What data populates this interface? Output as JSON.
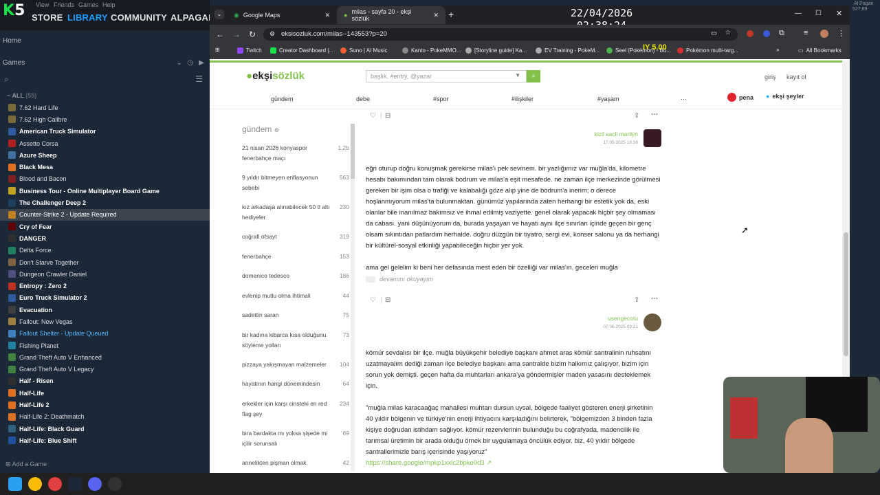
{
  "steam": {
    "brand": "5",
    "menu": [
      "View",
      "Friends",
      "Games",
      "Help"
    ],
    "nav": [
      "STORE",
      "LIBRARY",
      "COMMUNITY",
      "ALPAGAN"
    ],
    "home": "Home",
    "games_header": "Games",
    "all_label": "ALL",
    "all_count": "(55)",
    "games": [
      {
        "name": "7.62 Hard Life",
        "icon_color": "#7a6a3a"
      },
      {
        "name": "7.62 High Calibre",
        "icon_color": "#7a6a3a"
      },
      {
        "name": "American Truck Simulator",
        "icon_color": "#2d5aa0",
        "bold": true
      },
      {
        "name": "Assetto Corsa",
        "icon_color": "#b02020"
      },
      {
        "name": "Azure Sheep",
        "icon_color": "#3e6fa0",
        "bold": true
      },
      {
        "name": "Black Mesa",
        "icon_color": "#e07020",
        "bold": true
      },
      {
        "name": "Blood and Bacon",
        "icon_color": "#802020"
      },
      {
        "name": "Business Tour - Online Multiplayer Board Game",
        "icon_color": "#c0a020",
        "bold": true
      },
      {
        "name": "The Challenger Deep 2",
        "icon_color": "#204060",
        "bold": true
      },
      {
        "name": "Counter-Strike 2 - Update Required",
        "icon_color": "#c08020",
        "selected": true
      },
      {
        "name": "Cry of Fear",
        "icon_color": "#600000",
        "bold": true
      },
      {
        "name": "DANGER",
        "icon_color": "#303030",
        "bold": true
      },
      {
        "name": "Delta Force",
        "icon_color": "#208060"
      },
      {
        "name": "Don't Starve Together",
        "icon_color": "#806040"
      },
      {
        "name": "Dungeon Crawler Daniel",
        "icon_color": "#505080"
      },
      {
        "name": "Entropy : Zero 2",
        "icon_color": "#c03020",
        "bold": true
      },
      {
        "name": "Euro Truck Simulator 2",
        "icon_color": "#2d5aa0",
        "bold": true
      },
      {
        "name": "Evacuation",
        "icon_color": "#404040",
        "bold": true
      },
      {
        "name": "Fallout: New Vegas",
        "icon_color": "#a08040"
      },
      {
        "name": "Fallout Shelter - Update Queued",
        "icon_color": "#4080c0",
        "update": true
      },
      {
        "name": "Fishing Planet",
        "icon_color": "#2080a0"
      },
      {
        "name": "Grand Theft Auto V Enhanced",
        "icon_color": "#408040"
      },
      {
        "name": "Grand Theft Auto V Legacy",
        "icon_color": "#408040"
      },
      {
        "name": "Half - Risen",
        "icon_color": "#303030",
        "bold": true
      },
      {
        "name": "Half-Life",
        "icon_color": "#e07020",
        "bold": true
      },
      {
        "name": "Half-Life 2",
        "icon_color": "#e07020",
        "bold": true
      },
      {
        "name": "Half-Life 2: Deathmatch",
        "icon_color": "#e07020"
      },
      {
        "name": "Half-Life: Black Guard",
        "icon_color": "#306080",
        "bold": true
      },
      {
        "name": "Half-Life: Blue Shift",
        "icon_color": "#2050a0",
        "bold": true
      }
    ],
    "add_game": "Add a Game"
  },
  "browser": {
    "tabs": [
      {
        "label": "Google Maps"
      },
      {
        "label": "milas - sayfa 20 - ekşi sözlük"
      }
    ],
    "url": "eksisozluk.com/milas--143553?p=20",
    "bookmarks": [
      "Twitch",
      "Creator Dashboard |...",
      "Suno | AI Music",
      "Kanto - PokeMMO...",
      "[Storyline guide] Ka...",
      "EV Training - PokeM...",
      "Seel (Pokémon) - Bu...",
      "Pokémon multi-targ..."
    ],
    "all_bookmarks": "All Bookmarks",
    "datetime": "22/04/2026 02:38:24",
    "overlay_text": "IY 5.00"
  },
  "site": {
    "logo_a": "ekşi",
    "logo_b": "sözlük",
    "search_placeholder": "başlık, #entry, @yazar",
    "login": "giriş",
    "register": "kayıt ol",
    "nav": [
      "gündem",
      "debe",
      "#spor",
      "#ilişkiler",
      "#yaşam",
      "···"
    ],
    "pena": "pena",
    "eksi_seyler": "ekşi şeyler",
    "sidebar_title": "gündem",
    "sidebar": [
      {
        "title": "21 nisan 2026 konyaspor fenerbahçe maçı",
        "count": "1,2b"
      },
      {
        "title": "9 yıldır bitmeyen enflasyonun sebebi",
        "count": "563"
      },
      {
        "title": "kız arkadaşa alınabilecek 50 tl altı hediyeler",
        "count": "230"
      },
      {
        "title": "coğrafi ofsayt",
        "count": "319"
      },
      {
        "title": "fenerbahçe",
        "count": "153"
      },
      {
        "title": "domenico tedesco",
        "count": "186"
      },
      {
        "title": "evlenip mutlu olma ihtimali",
        "count": "44"
      },
      {
        "title": "sadettin saran",
        "count": "75"
      },
      {
        "title": "bir kadına kibarca kısa olduğunu söyleme yolları",
        "count": "73"
      },
      {
        "title": "pizzaya yakışmayan malzemeler",
        "count": "104"
      },
      {
        "title": "hayatının hangi dönemindesin",
        "count": "64"
      },
      {
        "title": "erkekler için karşı cinsteki en red flag şey",
        "count": "234"
      },
      {
        "title": "bira bardakta mı yoksa şişede mi içilir sorunsalı",
        "count": "69"
      },
      {
        "title": "annelikten pişman olmak",
        "count": "42"
      }
    ],
    "entry1": {
      "author": "kizil sacli marilyn",
      "date": "17.05.2025 18:36",
      "text": "eğri oturup doğru konuşmak gerekirse milas'ı pek sevmem. bir yazlığımız var muğla'da, kilometre hesabı bakımından tam olarak bodrum ve milas'a eşit mesafede. ne zaman ilçe merkezinde görülmesi gereken bir işim olsa o trafiği ve kalabalığı gözе alıp yine de bodrum'a inerim; o derece hoşlanmıyorum milas'ta bulunmaktan. günümüz yapılarında zaten herhangi bir estetik yok da, eski olanlar bile inanılmaz bakımsız ve ihmal edilmiş vaziyette. genel olarak yapacak hiçbir şey olmaması da cabası. yani düşünüyorum da, burada yaşayan ve hayatı aynı ilçe sınırları içinde geçen bir genç olsam sıkıntıdan patlardım herhalde. doğru düzgün bir tiyatro, sergi evi, konser salonu ya da herhangi bir kültürel-sosyal etkinliği yapabileceğin hiçbir yer yok.",
      "text2": "ama gel gelelim ki beni her defasında mest eden bir özelliği var milas'ın. geceleri muğla",
      "more": "devamını okuyayım"
    },
    "entry2": {
      "author": "usengecotu",
      "date": "07.06.2025 03:21",
      "text": "kömür sevdalısı bir ilçe. muğla büyükşehir belediye başkanı ahmet aras kömür santralinin ruhsatını uzatmayalım dediği zaman ilçe belediye başkanı ama santralde bizim halkımız çalışıyor, bizim için sorun yok demişti. geçen hafta da muhtarları ankara'ya göndermişler maden yasasını desteklemek için.",
      "quote": "\"muğla milas karacaağaç mahallesi muhtarı dursun uysal, bölgede faaliyet gösteren enerji şirketinin 40 yıldır bölgenin ve türkiye'nin enerji ihtiyacını karşıladığını belirterek, \"bölgemizden 3 binden fazla kişiye doğrudan istihdam sağlıyor. kömür rezervlerinin bulunduğu bu coğrafyada, madencilik ile tarımsal üretimin bir arada olduğu örnek bir uygulamaya öncülük ediyor. biz, 40 yıldır bölgede santrallerimizle barış içerisinde yaşıyoruz\"",
      "link": "https://share.google/mpkp1xxlc2bpko0d3"
    }
  },
  "right": {
    "user": "Al Pagan",
    "amount": "527,89"
  },
  "colors": {
    "accent": "#81c14b",
    "steam_bg": "#1b2838",
    "steam_blue": "#1a9fff"
  }
}
